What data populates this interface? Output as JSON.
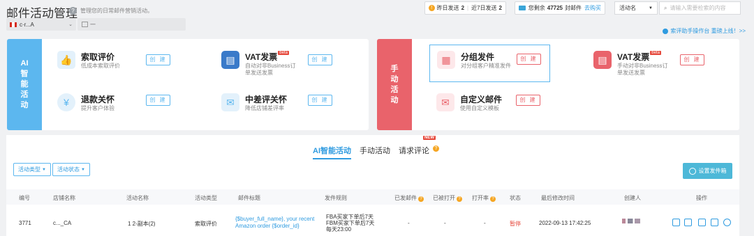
{
  "header": {
    "title": "邮件活动管理",
    "subtitle": "管理您的日常邮件营销活动。",
    "yesterday_label": "昨日发送",
    "yesterday_value": "2",
    "last7_label": "近7日发送",
    "last7_value": "2",
    "remaining_prefix": "您剩余",
    "remaining_value": "47725",
    "remaining_suffix": "封邮件",
    "recharge_label": "去购买",
    "activity_select": "活动名",
    "search_placeholder": "请输入需要检索的内容",
    "store_select": "c·r...A",
    "date_value": "一",
    "tutorial_link": "索评助手操作台 重磅上线！>>"
  },
  "ai_panel": {
    "side_label": [
      "AI",
      "智",
      "能",
      "活",
      "动"
    ],
    "cards": [
      {
        "title": "索取评价",
        "desc": "低成本索取评价",
        "btn": "创 建"
      },
      {
        "title": "VAT发票",
        "beta": "beta",
        "desc": "自动对非Business订单发送发票",
        "btn": "创 建"
      },
      {
        "title": "退款关怀",
        "desc": "提升客户体验",
        "btn": "创 建"
      },
      {
        "title": "中差评关怀",
        "desc": "降低店铺差评率",
        "btn": "创 建"
      }
    ]
  },
  "manual_panel": {
    "side_label": [
      "手",
      "动",
      "活",
      "动"
    ],
    "cards": [
      {
        "title": "分组发件",
        "desc": "对分组客户精准发件",
        "btn": "创 建"
      },
      {
        "title": "VAT发票",
        "beta": "beta",
        "desc": "手动对非Business订单发送发票",
        "btn": "创 建"
      },
      {
        "title": "自定义邮件",
        "desc": "使用自定义模板",
        "btn": "创 建"
      }
    ]
  },
  "tabs": {
    "ai": "AI智能活动",
    "manual": "手动活动",
    "review": "请求评论",
    "new_badge": "NEW"
  },
  "filters": {
    "type": "活动类型",
    "status": "活动状态",
    "settings": "设置发件箱"
  },
  "table": {
    "headers": [
      "编号",
      "店铺名称",
      "活动名称",
      "活动类型",
      "邮件标题",
      "发件规则",
      "已发邮件",
      "已被打开",
      "打开率",
      "状态",
      "最后修改时间",
      "创建人",
      "操作"
    ],
    "row": {
      "id": "3771",
      "store": "c..._CA",
      "name": "1 2-副本(2)",
      "type": "索取评价",
      "subject_1": "{$buyer_full_name}, your recent",
      "subject_2": "Amazon order {$order_id}",
      "rule_1": "FBA买家下单后7天",
      "rule_2": "FBM买家下单后7天",
      "rule_3": "每天23:00",
      "sent": "-",
      "opened": "-",
      "open_rate": "-",
      "status": "暂停",
      "modified": "2022-09-13 17:42:25"
    }
  },
  "colors": {
    "ai_accent": "#5cb7ef",
    "manual_accent": "#e9636b",
    "link": "#2f9be0",
    "warning": "#f5a623"
  }
}
